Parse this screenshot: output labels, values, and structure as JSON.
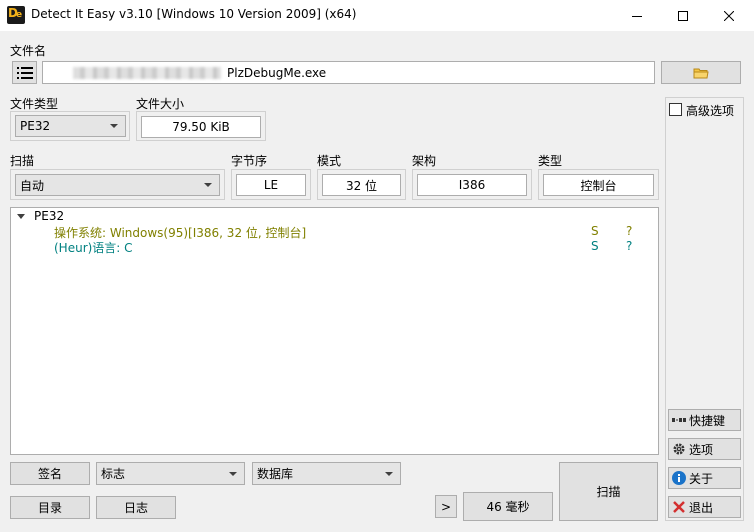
{
  "window": {
    "title": "Detect It Easy v3.10 [Windows 10 Version 2009] (x64)",
    "logo_text": "DiE"
  },
  "file": {
    "label": "文件名",
    "path_visible": "PlzDebugMe.exe"
  },
  "file_type": {
    "label": "文件类型",
    "value": "PE32"
  },
  "file_size": {
    "label": "文件大小",
    "value": "79.50 KiB"
  },
  "advanced": {
    "label": "高级选项",
    "checked": false
  },
  "scan_mode": {
    "label": "扫描",
    "value": "自动"
  },
  "endianness": {
    "label": "字节序",
    "value": "LE"
  },
  "mode": {
    "label": "模式",
    "value": "32 位"
  },
  "arch": {
    "label": "架构",
    "value": "I386"
  },
  "type": {
    "label": "类型",
    "value": "控制台"
  },
  "results": {
    "root": "PE32",
    "rows": [
      {
        "text": "操作系统: Windows(95)[I386, 32 位, 控制台]",
        "flag": "S",
        "info": "?",
        "color": "#808000"
      },
      {
        "text": "(Heur)语言: C",
        "flag": "S",
        "info": "?",
        "color": "#008080"
      }
    ]
  },
  "side": {
    "shortcuts": "快捷键",
    "options": "选项",
    "about": "关于",
    "exit": "退出"
  },
  "bottom": {
    "signature_btn": "签名",
    "flags_combo": "标志",
    "database_combo": "数据库",
    "directory_btn": "目录",
    "log_btn": "日志",
    "more_btn": ">",
    "time_btn": "46 毫秒",
    "scan_btn": "扫描"
  },
  "colors": {
    "os_result": "#808000",
    "heur_result": "#008080",
    "info_icon": "#1a73c9",
    "exit_icon": "#d32f2f",
    "folder_icon": "#f5c542"
  }
}
